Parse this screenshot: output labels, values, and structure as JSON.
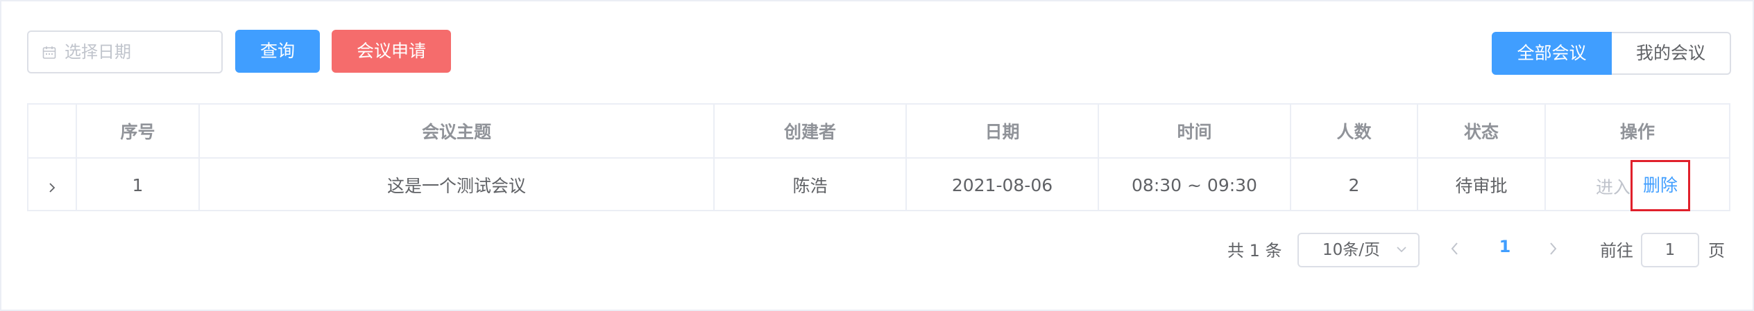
{
  "toolbar": {
    "date_placeholder": "选择日期",
    "query_label": "查询",
    "apply_label": "会议申请",
    "tabs": [
      {
        "label": "全部会议",
        "active": true
      },
      {
        "label": "我的会议",
        "active": false
      }
    ]
  },
  "table": {
    "headers": [
      "",
      "序号",
      "会议主题",
      "创建者",
      "日期",
      "时间",
      "人数",
      "状态",
      "操作"
    ],
    "rows": [
      {
        "index": "1",
        "topic": "这是一个测试会议",
        "creator": "陈浩",
        "date": "2021-08-06",
        "time": "08:30 ~ 09:30",
        "count": "2",
        "status": "待审批",
        "actions": {
          "enter": "进入",
          "delete": "删除"
        }
      }
    ]
  },
  "pagination": {
    "total": "共 1 条",
    "page_size": "10条/页",
    "current_page": "1",
    "goto_label": "前往",
    "goto_value": "1",
    "page_unit": "页"
  },
  "colors": {
    "primary": "#409eff",
    "danger": "#f56c6c",
    "highlight_box": "#e0202b"
  },
  "icons": {
    "date": "calendar-icon",
    "expand": "chevron-right-icon",
    "size_select": "chevron-down-icon",
    "prev": "chevron-left-icon",
    "next": "chevron-right-icon"
  }
}
